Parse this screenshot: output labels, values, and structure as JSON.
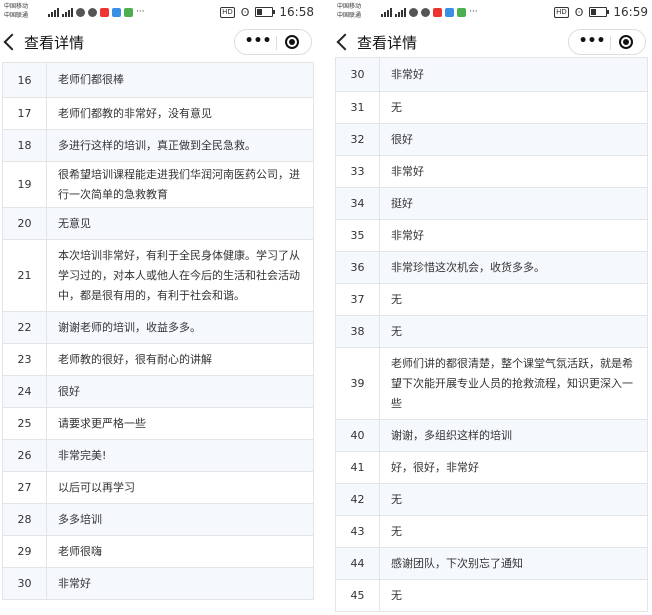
{
  "left": {
    "status": {
      "carrier1": "中国移动",
      "carrier2": "中国联通",
      "net1": "4G",
      "net2": "3G",
      "time": "16:58"
    },
    "nav": {
      "title": "查看详情",
      "more": "•••"
    },
    "rows": [
      {
        "no": "16",
        "text": "老师们都很棒",
        "shade": true
      },
      {
        "no": "17",
        "text": "老师们都教的非常好，没有意见",
        "shade": false
      },
      {
        "no": "18",
        "text": "多进行这样的培训，真正做到全民急救。",
        "shade": true
      },
      {
        "no": "19",
        "text": "很希望培训课程能走进我们华润河南医药公司，进行一次简单的急救教育",
        "shade": false
      },
      {
        "no": "20",
        "text": "无意见",
        "shade": true
      },
      {
        "no": "21",
        "text": "本次培训非常好，有利于全民身体健康。学习了从学习过的，对本人或他人在今后的生活和社会活动中，都是很有用的，有利于社会和谐。",
        "shade": false
      },
      {
        "no": "22",
        "text": "谢谢老师的培训，收益多多。",
        "shade": true
      },
      {
        "no": "23",
        "text": "老师教的很好，很有耐心的讲解",
        "shade": false
      },
      {
        "no": "24",
        "text": "很好",
        "shade": true
      },
      {
        "no": "25",
        "text": "请要求更严格一些",
        "shade": false
      },
      {
        "no": "26",
        "text": "非常完美!",
        "shade": true
      },
      {
        "no": "27",
        "text": "以后可以再学习",
        "shade": false
      },
      {
        "no": "28",
        "text": "多多培训",
        "shade": true
      },
      {
        "no": "29",
        "text": "老师很嗨",
        "shade": false
      },
      {
        "no": "30",
        "text": "非常好",
        "shade": true
      }
    ]
  },
  "right": {
    "status": {
      "carrier1": "中国移动",
      "carrier2": "中国联通",
      "net1": "4G",
      "net2": "3G",
      "time": "16:59"
    },
    "nav": {
      "title": "查看详情",
      "more": "•••"
    },
    "rows": [
      {
        "no": "30",
        "text": "非常好",
        "shade": true
      },
      {
        "no": "31",
        "text": "无",
        "shade": false
      },
      {
        "no": "32",
        "text": "很好",
        "shade": true
      },
      {
        "no": "33",
        "text": "非常好",
        "shade": false
      },
      {
        "no": "34",
        "text": "挺好",
        "shade": true
      },
      {
        "no": "35",
        "text": "非常好",
        "shade": false
      },
      {
        "no": "36",
        "text": "非常珍惜这次机会，收货多多。",
        "shade": true
      },
      {
        "no": "37",
        "text": "无",
        "shade": false
      },
      {
        "no": "38",
        "text": "无",
        "shade": true
      },
      {
        "no": "39",
        "text": "老师们讲的都很清楚，整个课堂气氛活跃，就是希望下次能开展专业人员的抢救流程，知识更深入一些",
        "shade": false
      },
      {
        "no": "40",
        "text": "谢谢，多组织这样的培训",
        "shade": true
      },
      {
        "no": "41",
        "text": "好，很好，非常好",
        "shade": false
      },
      {
        "no": "42",
        "text": "无",
        "shade": true
      },
      {
        "no": "43",
        "text": "无",
        "shade": false
      },
      {
        "no": "44",
        "text": "感谢团队，下次别忘了通知",
        "shade": true
      },
      {
        "no": "45",
        "text": "无",
        "shade": false
      }
    ]
  }
}
